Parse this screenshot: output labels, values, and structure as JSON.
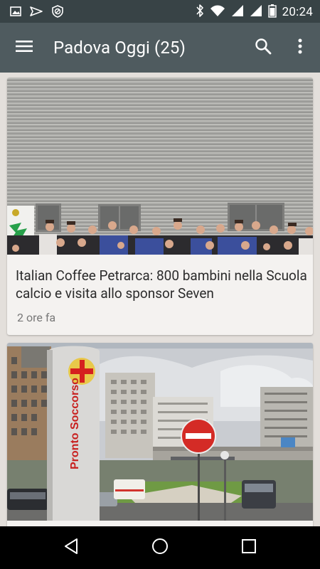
{
  "status_bar": {
    "time": "20:24",
    "left_icons": [
      "image-icon",
      "send-icon",
      "blocked-icon"
    ],
    "right_icons": [
      "bluetooth-icon",
      "wifi-icon",
      "signal-icon",
      "signal-icon",
      "battery-icon"
    ]
  },
  "app_bar": {
    "title": "Padova Oggi (25)",
    "icons": [
      "menu-icon",
      "search-icon",
      "more-vert-icon"
    ]
  },
  "articles": [
    {
      "title": "Italian Coffee Petrarca: 800 bambini nella Scuola calcio e visita allo sponsor Seven",
      "time": "2 ore fa"
    },
    {
      "title": "",
      "time": "",
      "image_sign_text": "Pronto Soccorso"
    }
  ],
  "nav_bar": {
    "icons": [
      "back-icon",
      "home-icon",
      "recents-icon"
    ]
  },
  "colors": {
    "status_bar": "#384346",
    "app_bar": "#4f5b5f",
    "background": "#e3dfdb",
    "card": "#f4f2f0"
  }
}
